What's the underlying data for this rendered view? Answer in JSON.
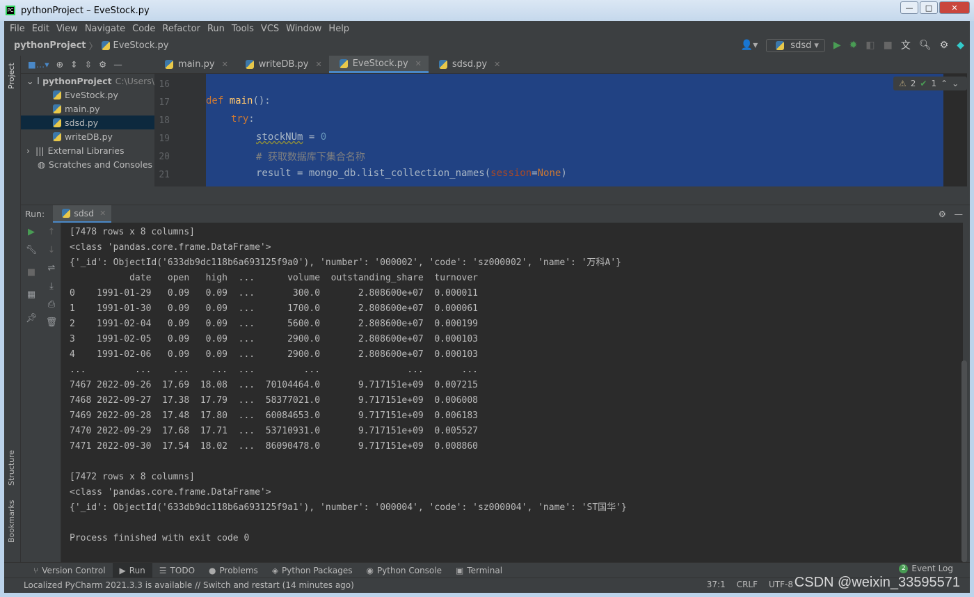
{
  "window": {
    "title": "pythonProject – EveStock.py",
    "logo": "PC"
  },
  "menu": [
    "File",
    "Edit",
    "View",
    "Navigate",
    "Code",
    "Refactor",
    "Run",
    "Tools",
    "VCS",
    "Window",
    "Help"
  ],
  "nav": {
    "project": "pythonProject",
    "file": "EveStock.py",
    "run_config": "sdsd"
  },
  "left_strip": {
    "project": "Project",
    "structure": "Structure",
    "bookmarks": "Bookmarks"
  },
  "project_tree": {
    "root": "pythonProject",
    "root_path": "C:\\Users\\",
    "files": [
      "EveStock.py",
      "main.py",
      "sdsd.py",
      "writeDB.py"
    ],
    "selected": "sdsd.py",
    "external": "External Libraries",
    "scratches": "Scratches and Consoles"
  },
  "tabs": [
    {
      "label": "main.py"
    },
    {
      "label": "writeDB.py"
    },
    {
      "label": "EveStock.py",
      "active": true
    },
    {
      "label": "sdsd.py"
    }
  ],
  "inspections": {
    "warnings": "2",
    "typos": "1"
  },
  "code": {
    "lines": [
      "16",
      "17",
      "18",
      "19",
      "20",
      "21"
    ],
    "l17_kw": "def",
    "l17_fn": "main",
    "l17_rest": "():",
    "l18_kw": "try",
    "l18_rest": ":",
    "l19_var": "stockNUm",
    "l19_eq": " = ",
    "l19_num": "0",
    "l20": "# 获取数据库下集合名称",
    "l21_a": "result = mongo_db.list_collection_names(",
    "l21_p": "session",
    "l21_eq": "=",
    "l21_none": "None",
    "l21_end": ")"
  },
  "run": {
    "label": "Run:",
    "tab": "sdsd"
  },
  "console": [
    "[7478 rows x 8 columns]",
    "<class 'pandas.core.frame.DataFrame'>",
    "{'_id': ObjectId('633db9dc118b6a693125f9a0'), 'number': '000002', 'code': 'sz000002', 'name': '万科A'}",
    "           date   open   high  ...      volume  outstanding_share  turnover",
    "0    1991-01-29   0.09   0.09  ...       300.0       2.808600e+07  0.000011",
    "1    1991-01-30   0.09   0.09  ...      1700.0       2.808600e+07  0.000061",
    "2    1991-02-04   0.09   0.09  ...      5600.0       2.808600e+07  0.000199",
    "3    1991-02-05   0.09   0.09  ...      2900.0       2.808600e+07  0.000103",
    "4    1991-02-06   0.09   0.09  ...      2900.0       2.808600e+07  0.000103",
    "...         ...    ...    ...  ...         ...                ...       ...",
    "7467 2022-09-26  17.69  18.08  ...  70104464.0       9.717151e+09  0.007215",
    "7468 2022-09-27  17.38  17.79  ...  58377021.0       9.717151e+09  0.006008",
    "7469 2022-09-28  17.48  17.80  ...  60084653.0       9.717151e+09  0.006183",
    "7470 2022-09-29  17.68  17.71  ...  53710931.0       9.717151e+09  0.005527",
    "7471 2022-09-30  17.54  18.02  ...  86090478.0       9.717151e+09  0.008860",
    "",
    "[7472 rows x 8 columns]",
    "<class 'pandas.core.frame.DataFrame'>",
    "{'_id': ObjectId('633db9dc118b6a693125f9a1'), 'number': '000004', 'code': 'sz000004', 'name': 'ST国华'}",
    "",
    "Process finished with exit code 0"
  ],
  "bottom_tabs": [
    "Version Control",
    "Run",
    "TODO",
    "Problems",
    "Python Packages",
    "Python Console",
    "Terminal"
  ],
  "event_log": {
    "count": "2",
    "label": "Event Log"
  },
  "status": {
    "message": "Localized PyCharm 2021.3.3 is available // Switch and restart (14 minutes ago)",
    "position": "37:1",
    "line_sep": "CRLF",
    "encoding": "UTF-8"
  },
  "watermark": "CSDN @weixin_33595571"
}
